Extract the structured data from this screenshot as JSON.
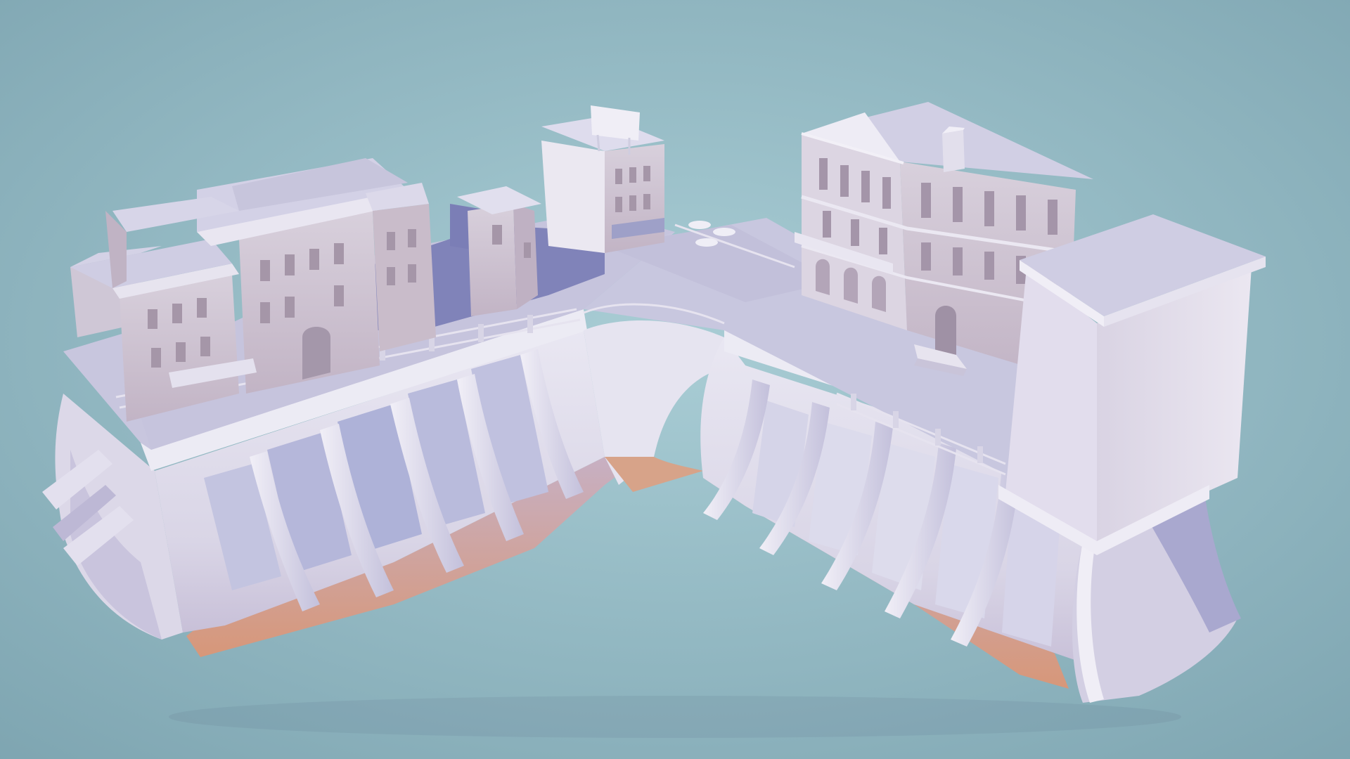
{
  "scene": {
    "subject": "untextured-3d-city-block-render",
    "colors": {
      "background_center": "#a7cbd3",
      "background_edge": "#7fa6b2",
      "surface_light": "#e8e6f2",
      "surface_mid": "#cfcbe0",
      "surface_shadow": "#8f90bf",
      "ground_shadow": "#7d7fb8",
      "warm_underside": "#d4957a",
      "building_wall": "#d3c8d4",
      "building_wall_dark": "#b7a9bb",
      "roof": "#c9c7dc",
      "window": "#a796a8"
    },
    "objects": [
      {
        "name": "left-townhouse-cluster",
        "kind": "building"
      },
      {
        "name": "small-tower-building",
        "kind": "building"
      },
      {
        "name": "billboard-building",
        "kind": "building"
      },
      {
        "name": "classical-mansion",
        "kind": "building"
      },
      {
        "name": "tall-block-tower",
        "kind": "building"
      },
      {
        "name": "l-shaped-plaza",
        "kind": "platform"
      },
      {
        "name": "curved-retaining-wall",
        "kind": "structure"
      },
      {
        "name": "stone-railing",
        "kind": "structure"
      }
    ]
  }
}
